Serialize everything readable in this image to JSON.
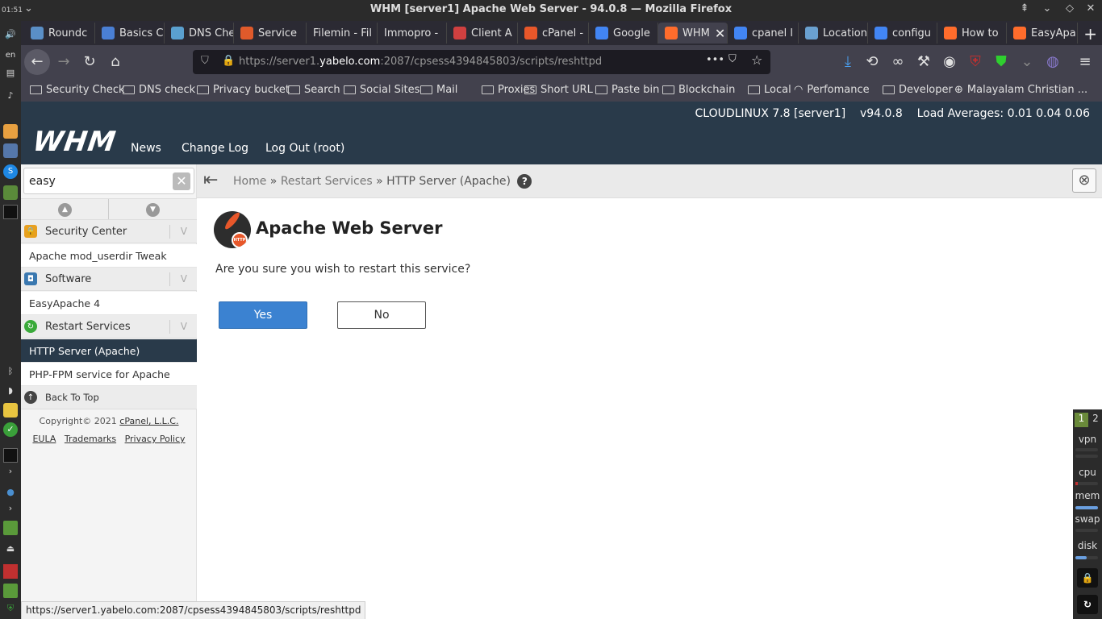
{
  "titlebar": {
    "clock": "01:51",
    "title": "WHM [server1] Apache Web Server - 94.0.8 — Mozilla Firefox"
  },
  "tabs": [
    {
      "label": "Roundc",
      "icon": "roundcube-icon",
      "color": "#5a8fc7"
    },
    {
      "label": "Basics C",
      "icon": "docs-icon",
      "color": "#4a7fd4"
    },
    {
      "label": "DNS Che",
      "icon": "dns-checker-icon",
      "color": "#5aa0d0"
    },
    {
      "label": "Service",
      "icon": "x-logo-icon",
      "color": "#e05a2b"
    },
    {
      "label": "Filemin - Fil",
      "icon": "",
      "color": ""
    },
    {
      "label": "Immopro -",
      "icon": "",
      "color": ""
    },
    {
      "label": "Client A",
      "icon": "client-area-icon",
      "color": "#d04040"
    },
    {
      "label": "cPanel -",
      "icon": "cpanel-icon",
      "color": "#e8572a"
    },
    {
      "label": "Google",
      "icon": "google-icon",
      "color": "#4285f4"
    },
    {
      "label": "WHM",
      "icon": "cpanel-icon",
      "color": "#ff6c2c"
    },
    {
      "label": "cpanel l",
      "icon": "google-icon",
      "color": "#4285f4"
    },
    {
      "label": "Location",
      "icon": "location-icon",
      "color": "#6aa0d0"
    },
    {
      "label": "configu",
      "icon": "google-icon",
      "color": "#4285f4"
    },
    {
      "label": "How to",
      "icon": "cpanel-icon",
      "color": "#ff6c2c"
    },
    {
      "label": "EasyApa",
      "icon": "cpanel-icon",
      "color": "#ff6c2c"
    }
  ],
  "address": {
    "prefix": "https://server1.",
    "domain": "yabelo.com",
    "rest": ":2087/cpsess4394845803/scripts/reshttpd"
  },
  "bookmarks": [
    "Security Check",
    "DNS check",
    "Privacy bucket",
    "Search",
    "Social Sites",
    "Mail",
    "Proxies",
    "Short URL",
    "Paste bin",
    "Blockchain",
    "Local",
    "Perfomance",
    "Developer",
    "Malayalam Christian ..."
  ],
  "whm": {
    "sysinfo": "CLOUDLINUX 7.8 [server1]    v94.0.8    Load Averages: 0.01 0.04 0.06",
    "logo": "WHM",
    "nav": [
      "News",
      "Change Log",
      "Log Out (root)"
    ]
  },
  "sidebar": {
    "search_value": "easy",
    "categories": [
      {
        "label": "Security Center",
        "icon": "lock-icon",
        "items": [
          "Apache mod_userdir Tweak"
        ]
      },
      {
        "label": "Software",
        "icon": "software-icon",
        "items": [
          "EasyApache 4"
        ]
      },
      {
        "label": "Restart Services",
        "icon": "restart-icon",
        "items": [
          "HTTP Server (Apache)",
          "PHP-FPM service for Apache"
        ]
      }
    ],
    "back_to_top": "Back To Top",
    "copyright": "Copyright© 2021",
    "copyright_link": "cPanel, L.L.C.",
    "links": [
      "EULA",
      "Trademarks",
      "Privacy Policy"
    ]
  },
  "breadcrumb": {
    "home": "Home",
    "sep": "»",
    "restart": "Restart Services",
    "current": "HTTP Server (Apache)"
  },
  "main": {
    "title": "Apache Web Server",
    "logo_badge": "HTTP",
    "question": "Are you sure you wish to restart this service?",
    "yes": "Yes",
    "no": "No"
  },
  "rightpanel": {
    "workspaces": [
      "1",
      "2"
    ],
    "labels": [
      "vpn",
      "cpu",
      "mem",
      "swap",
      "disk"
    ]
  },
  "statusbar": "https://server1.yabelo.com:2087/cpsess4394845803/scripts/reshttpd"
}
